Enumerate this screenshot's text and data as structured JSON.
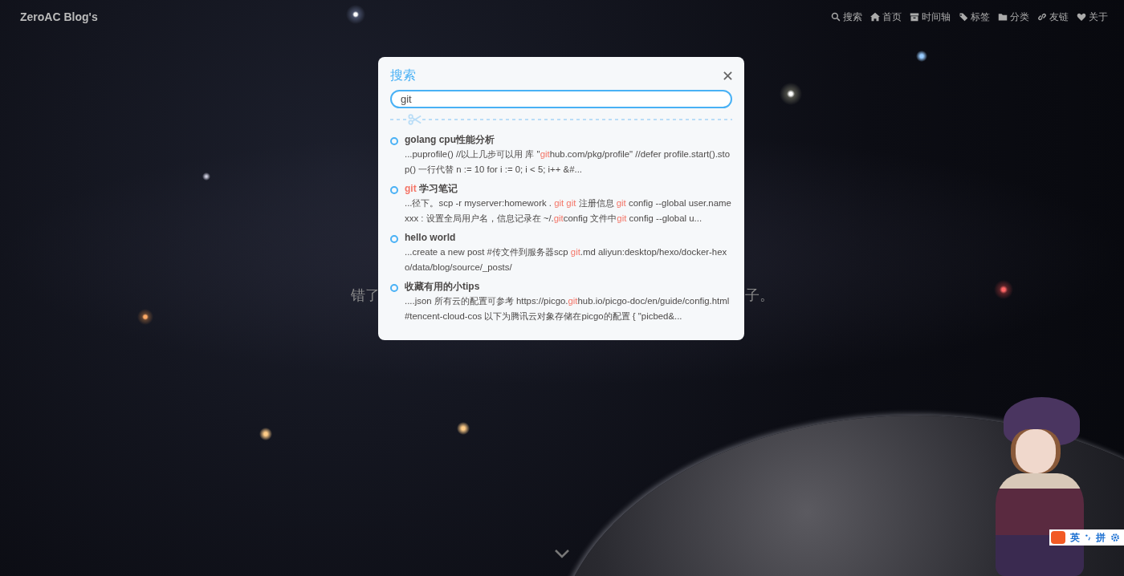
{
  "site_title": "ZeroAC Blog's",
  "nav": [
    {
      "kind": "search",
      "label": "搜索"
    },
    {
      "kind": "home",
      "label": "首页"
    },
    {
      "kind": "archive",
      "label": "时间轴"
    },
    {
      "kind": "tags",
      "label": "标签"
    },
    {
      "kind": "folder",
      "label": "分类"
    },
    {
      "kind": "link",
      "label": "友链"
    },
    {
      "kind": "heart",
      "label": "关于"
    }
  ],
  "hero_text": {
    "left": "错了",
    "right": "子。"
  },
  "search": {
    "title": "搜索",
    "query": "git",
    "results": [
      {
        "title": [
          {
            "text": "golang cpu性能分析",
            "hit": false
          }
        ],
        "snippet": [
          {
            "text": "...puprofile() //以上几步可以用 库 \"",
            "hit": false
          },
          {
            "text": "git",
            "hit": true
          },
          {
            "text": "hub.com/pkg/profile\" //defer profile.start().stop() 一行代替 n := 10 for i := 0; i < 5; i++ &#...",
            "hit": false
          }
        ]
      },
      {
        "title": [
          {
            "text": "git",
            "hit": true
          },
          {
            "text": " 学习笔记",
            "hit": false
          }
        ],
        "snippet": [
          {
            "text": "...径下。scp -r myserver:homework . ",
            "hit": false
          },
          {
            "text": "git git",
            "hit": true
          },
          {
            "text": " 注册信息 ",
            "hit": false
          },
          {
            "text": "git",
            "hit": true
          },
          {
            "text": " config --global user.name xxx : 设置全局用户名，信息记录在 ~/.",
            "hit": false
          },
          {
            "text": "git",
            "hit": true
          },
          {
            "text": "config 文件中",
            "hit": false
          },
          {
            "text": "git",
            "hit": true
          },
          {
            "text": " config --global u...",
            "hit": false
          }
        ]
      },
      {
        "title": [
          {
            "text": "hello world",
            "hit": false
          }
        ],
        "snippet": [
          {
            "text": "...create a new post #传文件到服务器scp ",
            "hit": false
          },
          {
            "text": "git",
            "hit": true
          },
          {
            "text": ".md aliyun:desktop/hexo/docker-hexo/data/blog/source/_posts/",
            "hit": false
          }
        ]
      },
      {
        "title": [
          {
            "text": "收藏有用的小tips",
            "hit": false
          }
        ],
        "snippet": [
          {
            "text": "....json 所有云的配置可参考 https://picgo.",
            "hit": false
          },
          {
            "text": "git",
            "hit": true
          },
          {
            "text": "hub.io/picgo-doc/en/guide/config.html#tencent-cloud-cos 以下为腾讯云对象存储在picgo的配置 { \"picbed&...",
            "hit": false
          }
        ]
      }
    ]
  },
  "ime": {
    "mode": "英",
    "layout": "拼"
  }
}
